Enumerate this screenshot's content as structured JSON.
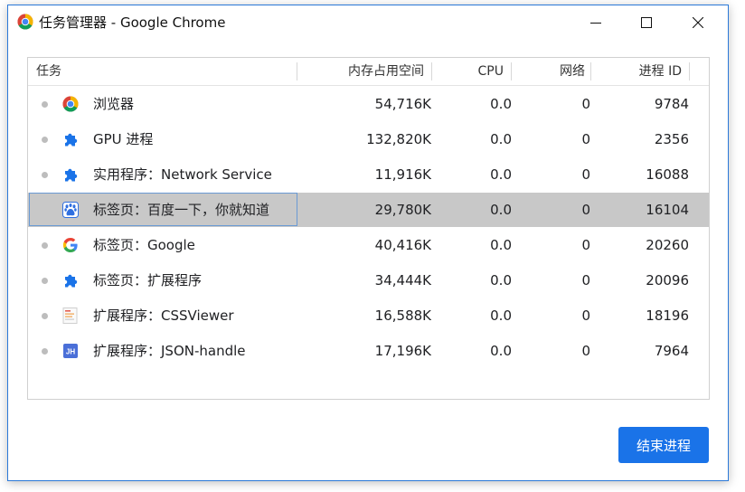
{
  "window": {
    "title": "任务管理器 - Google Chrome",
    "colors": {
      "border": "#2b79d8",
      "accent": "#1a73e8",
      "selected_row": "#c8c8c8"
    }
  },
  "table": {
    "headers": {
      "task": "任务",
      "memory": "内存占用空间",
      "cpu": "CPU",
      "network": "网络",
      "pid": "进程 ID"
    },
    "rows": [
      {
        "name": "浏览器",
        "icon": "chrome-icon",
        "memory": "54,716K",
        "cpu": "0.0",
        "network": "0",
        "pid": "9784",
        "selected": false
      },
      {
        "name": "GPU 进程",
        "icon": "puzzle-icon",
        "memory": "132,820K",
        "cpu": "0.0",
        "network": "0",
        "pid": "2356",
        "selected": false
      },
      {
        "name": "实用程序：Network Service",
        "icon": "puzzle-icon",
        "memory": "11,916K",
        "cpu": "0.0",
        "network": "0",
        "pid": "16088",
        "selected": false
      },
      {
        "name": "标签页：百度一下，你就知道",
        "icon": "baidu-paw-icon",
        "memory": "29,780K",
        "cpu": "0.0",
        "network": "0",
        "pid": "16104",
        "selected": true
      },
      {
        "name": "标签页：Google",
        "icon": "google-g-icon",
        "memory": "40,416K",
        "cpu": "0.0",
        "network": "0",
        "pid": "20260",
        "selected": false
      },
      {
        "name": "标签页：扩展程序",
        "icon": "puzzle-icon",
        "memory": "34,444K",
        "cpu": "0.0",
        "network": "0",
        "pid": "20096",
        "selected": false
      },
      {
        "name": "扩展程序：CSSViewer",
        "icon": "cssviewer-icon",
        "memory": "16,588K",
        "cpu": "0.0",
        "network": "0",
        "pid": "18196",
        "selected": false
      },
      {
        "name": "扩展程序：JSON-handle",
        "icon": "jh-icon",
        "memory": "17,196K",
        "cpu": "0.0",
        "network": "0",
        "pid": "7964",
        "selected": false
      }
    ]
  },
  "footer": {
    "end_process_label": "结束进程"
  }
}
